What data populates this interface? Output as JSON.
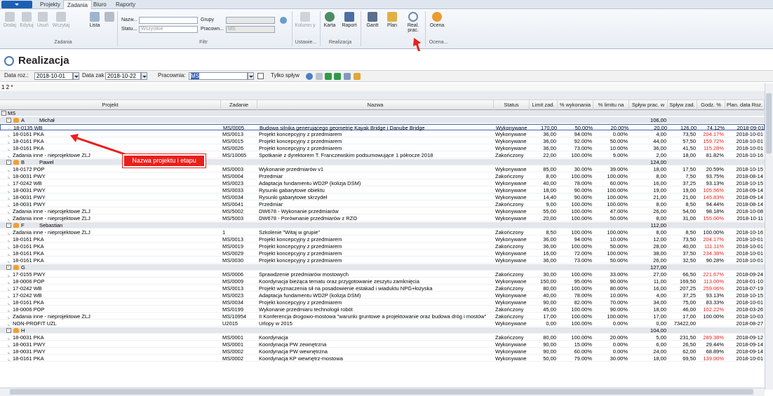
{
  "menu": {
    "tabs": [
      "Projekty",
      "Zadania",
      "Biuro",
      "Raporty"
    ],
    "active": "Zadania"
  },
  "ribbon": {
    "zadania": [
      "Dodaj",
      "Edytuj",
      "Usuń",
      "Wczytaj",
      "Lista"
    ],
    "zadania_group": "Zadania",
    "filter": {
      "nazwa_label": "Nazw...",
      "status_label": "Statu...",
      "status_value": "Wszystkie",
      "grupy_label": "Grupy",
      "pracownik_label": "Pracown...",
      "pracownik_value": "MS",
      "group": "Filtr"
    },
    "ustawienia": {
      "kolumny": "Kolumn y",
      "group": "Ustawie..."
    },
    "realizacja": {
      "karta": "Karta",
      "raport": "Raport",
      "group": "Realizacja"
    },
    "view": {
      "gantt": "Gantt",
      "plan": "Plan",
      "real": "Real. prac."
    },
    "ocena": {
      "label": "Ocena",
      "group": "Ocena..."
    }
  },
  "page": {
    "title": "Realizacja"
  },
  "filters": {
    "data_roz_label": "Data roz.:",
    "data_roz": "2018-10-01",
    "data_zak_label": "Data zak",
    "data_zak": "2018-10-22",
    "pracownia_label": "Pracownia:",
    "pracownia": "MS",
    "tylko_label": "Tylko spływ"
  },
  "pager": "1 2 *",
  "columns": [
    "Projekt",
    "Zadanie",
    "Nazwa",
    "Status",
    "Limit zad.",
    "% wykonania",
    "% limitu na",
    "Spływ prac. w",
    "Spływ zad.",
    "Godz. %",
    "Plan. data Roz."
  ],
  "callout": "Nazwa projektu i etapu",
  "rows": [
    {
      "t": "top",
      "label": "MS"
    },
    {
      "t": "grp",
      "letter": "A",
      "name": "Michał",
      "total": "106,00"
    },
    {
      "t": "d",
      "sel": true,
      "p": "18-0135 WB",
      "z": "MS/0005",
      "n": "Budowa silnika generującego geometrię Kayak Bridge i Danube Bridge",
      "s": "Wykonywane",
      "l": "170,00",
      "w": "50.00%",
      "ln": "20.00%",
      "sp": "20,00",
      "sz": "126,00",
      "g": "74.12%",
      "d": "2018-09-01",
      "red": false
    },
    {
      "t": "d",
      "p": "18-0161 PKA",
      "z": "MS/0013",
      "n": "Projekt koncepcyjny z przedmiarem",
      "s": "Wykonywane",
      "l": "36,00",
      "w": "94.00%",
      "ln": "0.00%",
      "sp": "4,00",
      "sz": "73,50",
      "g": "204.17%",
      "d": "2018-10-01",
      "red": true
    },
    {
      "t": "d",
      "p": "18-0161 PKA",
      "z": "MS/0015",
      "n": "Projekt koncepcyjny z przedmiarem",
      "s": "Wykonywane",
      "l": "36,00",
      "w": "92.00%",
      "ln": "50.00%",
      "sp": "44,00",
      "sz": "57,50",
      "g": "159.72%",
      "d": "2018-10-01",
      "red": true
    },
    {
      "t": "d",
      "p": "18-0161 PKA",
      "z": "MS/0026",
      "n": "Projekt koncepcyjny z przedmiarem",
      "s": "Wykonywane",
      "l": "36,00",
      "w": "73.00%",
      "ln": "10.00%",
      "sp": "36,00",
      "sz": "41,50",
      "g": "115.28%",
      "d": "2018-10-01",
      "red": true
    },
    {
      "t": "d",
      "p": "Zadania inne - nieprojektowe ZLJ",
      "z": "MS/10065",
      "n": "Spotkanie z dyrektorem T. Franczewskim podsumowujące 1 półrocze 2018",
      "s": "Zakończony",
      "l": "22,00",
      "w": "100.00%",
      "ln": "9.00%",
      "sp": "2,00",
      "sz": "18,00",
      "g": "81.82%",
      "d": "2018-10-16",
      "red": false
    },
    {
      "t": "grp",
      "letter": "B",
      "name": "Paweł",
      "total": "124,00"
    },
    {
      "t": "d",
      "p": "18-0172 POP",
      "z": "MS/0003",
      "n": "Wykonanie przedmiarów v1",
      "s": "Wykonywane",
      "l": "85,00",
      "w": "30.00%",
      "ln": "39.00%",
      "sp": "18,00",
      "sz": "17,50",
      "g": "20.59%",
      "d": "2018-10-15",
      "red": false
    },
    {
      "t": "d",
      "p": "18-0031 PWY",
      "z": "MS/0004",
      "n": "Przedmiar",
      "s": "Zakończony",
      "l": "8,00",
      "w": "100.00%",
      "ln": "100.00%",
      "sp": "8,00",
      "sz": "7,50",
      "g": "93.75%",
      "d": "2018-08-14",
      "red": false
    },
    {
      "t": "d",
      "p": "17-0242 WB",
      "z": "MS/0023",
      "n": "Adaptacja fundamentu WD2P (kolizja DSM)",
      "s": "Wykonywane",
      "l": "40,00",
      "w": "78.00%",
      "ln": "60.00%",
      "sp": "16,00",
      "sz": "37,25",
      "g": "93.13%",
      "d": "2018-10-15",
      "red": false
    },
    {
      "t": "d",
      "p": "18-0031 PWY",
      "z": "MS/0033",
      "n": "Rysunki gabarytowe obiektu",
      "s": "Wykonywane",
      "l": "18,00",
      "w": "90.00%",
      "ln": "100.00%",
      "sp": "19,00",
      "sz": "19,00",
      "g": "105.56%",
      "d": "2018-09-14",
      "red": true
    },
    {
      "t": "d",
      "p": "18-0031 PWY",
      "z": "MS/0034",
      "n": "Rysunki gabarytowe skrzydeł",
      "s": "Wykonywane",
      "l": "14,40",
      "w": "90.00%",
      "ln": "100.00%",
      "sp": "21,00",
      "sz": "21,00",
      "g": "145.83%",
      "d": "2018-09-14",
      "red": true
    },
    {
      "t": "d",
      "p": "18-0031 PWY",
      "z": "MS/0041",
      "n": "Przedmiar",
      "s": "Zakończony",
      "l": "9,00",
      "w": "100.00%",
      "ln": "100.00%",
      "sp": "8,00",
      "sz": "8,50",
      "g": "94.44%",
      "d": "2018-08-14",
      "red": false
    },
    {
      "t": "d",
      "p": "Zadania inne - nieprojektowe ZLJ",
      "z": "MS/5002",
      "n": "DW678 - Wykonanie przedmiarów",
      "s": "Wykonywane",
      "l": "55,00",
      "w": "100.00%",
      "ln": "47.00%",
      "sp": "26,00",
      "sz": "54,00",
      "g": "98.18%",
      "d": "2018-10-08",
      "red": false
    },
    {
      "t": "d",
      "p": "Zadania inne - nieprojektowe ZLJ",
      "z": "MS/5003",
      "n": "DW678 - Porównanie przedmiarów z RZO",
      "s": "Wykonywane",
      "l": "20,00",
      "w": "100.00%",
      "ln": "50.00%",
      "sp": "8,00",
      "sz": "31,00",
      "g": "155.00%",
      "d": "2018-10-11",
      "red": true
    },
    {
      "t": "grp",
      "letter": "F",
      "name": "Sebastian",
      "total": "112,00"
    },
    {
      "t": "d",
      "p": "Zadania inne - nieprojektowe ZLJ",
      "z": "1",
      "n": "Szkolenie \"Witaj w grupie\"",
      "s": "Zakończony",
      "l": "8,50",
      "w": "100.00%",
      "ln": "100.00%",
      "sp": "8,00",
      "sz": "8,50",
      "g": "100.00%",
      "d": "2018-10-16",
      "red": false
    },
    {
      "t": "d",
      "p": "18-0161 PKA",
      "z": "MS/0013",
      "n": "Projekt koncepcyjny z przedmiarem",
      "s": "Wykonywane",
      "l": "36,00",
      "w": "94.00%",
      "ln": "10.00%",
      "sp": "12,00",
      "sz": "73,50",
      "g": "204.17%",
      "d": "2018-10-01",
      "red": true
    },
    {
      "t": "d",
      "p": "18-0161 PKA",
      "z": "MS/0019",
      "n": "Projekt koncepcyjny z przedmiarem",
      "s": "Zakończony",
      "l": "36,00",
      "w": "100.00%",
      "ln": "50.00%",
      "sp": "28,00",
      "sz": "40,00",
      "g": "111.11%",
      "d": "2018-10-01",
      "red": true
    },
    {
      "t": "d",
      "p": "18-0161 PKA",
      "z": "MS/0029",
      "n": "Projekt koncepcyjny z przedmiarem",
      "s": "Wykonywane",
      "l": "16,00",
      "w": "72.00%",
      "ln": "100.00%",
      "sp": "38,00",
      "sz": "37,50",
      "g": "234.38%",
      "d": "2018-10-01",
      "red": true
    },
    {
      "t": "d",
      "p": "18-0161 PKA",
      "z": "MS/0030",
      "n": "Projekt koncepcyjny z przedmiarem",
      "s": "Wykonywane",
      "l": "36,00",
      "w": "73.00%",
      "ln": "50.00%",
      "sp": "26,00",
      "sz": "32,50",
      "g": "90.28%",
      "d": "2018-10-01",
      "red": false
    },
    {
      "t": "grp",
      "letter": "G",
      "name": "",
      "total": "127,00"
    },
    {
      "t": "d",
      "p": "17-0155 PWY",
      "z": "MS/0006",
      "n": "Sprawdzenie przedmiarów mostowych",
      "s": "Zakończony",
      "l": "30,00",
      "w": "100.00%",
      "ln": "33.00%",
      "sp": "27,00",
      "sz": "66,50",
      "g": "221.67%",
      "d": "2018-09-24",
      "red": true
    },
    {
      "t": "d",
      "p": "18-0006 POP",
      "z": "MS/0009",
      "n": "Koordynacja bieżąca tematu oraz przygotowanie zeszytu zamknięcia",
      "s": "Wykonywane",
      "l": "150,00",
      "w": "95.00%",
      "ln": "90.00%",
      "sp": "11,00",
      "sz": "169,50",
      "g": "113.00%",
      "d": "2018-01-10",
      "red": true
    },
    {
      "t": "d",
      "p": "17-0242 WB",
      "z": "MS/0013",
      "n": "Projekt wyznaczenia sił na posadowienie estakad i wiaduktu NPG+łożyska",
      "s": "Zakończony",
      "l": "80,00",
      "w": "100.00%",
      "ln": "80.00%",
      "sp": "16,00",
      "sz": "207,25",
      "g": "259.06%",
      "d": "2018-07-19",
      "red": true
    },
    {
      "t": "d",
      "p": "17-0242 WB",
      "z": "MS/0023",
      "n": "Adaptacja fundamentu WD2P (kolizja DSM)",
      "s": "Wykonywane",
      "l": "40,00",
      "w": "78.00%",
      "ln": "10.00%",
      "sp": "4,00",
      "sz": "37,25",
      "g": "93.13%",
      "d": "2018-10-15",
      "red": false
    },
    {
      "t": "d",
      "p": "18-0161 PKA",
      "z": "MS/0034",
      "n": "Projekt koncepcyjny z przedmiarem",
      "s": "Wykonywane",
      "l": "90,00",
      "w": "82.00%",
      "ln": "70.00%",
      "sp": "34,00",
      "sz": "75,00",
      "g": "83.33%",
      "d": "2018-10-01",
      "red": false
    },
    {
      "t": "d",
      "p": "18-0006 POP",
      "z": "MS/0199",
      "n": "Wykonanie przedmiaru technologii robót",
      "s": "Zakończony",
      "l": "45,00",
      "w": "100.00%",
      "ln": "90.00%",
      "sp": "18,00",
      "sz": "46,00",
      "g": "102.22%",
      "d": "2018-03-26",
      "red": true
    },
    {
      "t": "d",
      "p": "Zadania inne - nieprojektowe ZLJ",
      "z": "MS/10954",
      "n": "II Konferencja drogowo-mostowa \"warunki gruntowe a projektowanie oraz budowa dróg i mostów\"",
      "s": "Zakończony",
      "l": "17,00",
      "w": "100.00%",
      "ln": "100.00%",
      "sp": "17,00",
      "sz": "17,00",
      "g": "100.00%",
      "d": "2018-10-03",
      "red": false
    },
    {
      "t": "d",
      "p": "NON-PROFIT UZL",
      "z": "U2015",
      "n": "Urlopy w 2015",
      "s": "Wykonywane",
      "l": "0,00",
      "w": "100.00%",
      "ln": "0.00%",
      "sp": "0,00",
      "sz": "73422,00",
      "g": "",
      "d": "2018-08-27",
      "red": false
    },
    {
      "t": "grp",
      "letter": "H",
      "name": "",
      "total": "104,00"
    },
    {
      "t": "d",
      "p": "18-0031 PKA",
      "z": "MS/0001",
      "n": "Koordynacja",
      "s": "Zakończony",
      "l": "80,00",
      "w": "100.00%",
      "ln": "20.00%",
      "sp": "5,00",
      "sz": "231,50",
      "g": "289.38%",
      "d": "2018-09-12",
      "red": true
    },
    {
      "t": "d",
      "p": "18-0031 PWY",
      "z": "MS/0001",
      "n": "Koordynacja PW zewnętrzna",
      "s": "Wykonywane",
      "l": "90,00",
      "w": "15.00%",
      "ln": "0.00%",
      "sp": "6,00",
      "sz": "26,50",
      "g": "29.44%",
      "d": "2018-09-14",
      "red": false
    },
    {
      "t": "d",
      "p": "18-0031 PWY",
      "z": "MS/0002",
      "n": "Koordynacja PW wewnętrzna",
      "s": "Wykonywane",
      "l": "90,00",
      "w": "60.00%",
      "ln": "0.00%",
      "sp": "24,00",
      "sz": "62,00",
      "g": "68.89%",
      "d": "2018-09-14",
      "red": false
    },
    {
      "t": "d",
      "p": "18-0161 PKA",
      "z": "MS/0002",
      "n": "Koordynacja KP wewnętrz-mostowa",
      "s": "Wykonywane",
      "l": "50,00",
      "w": "79.00%",
      "ln": "30.00%",
      "sp": "18,00",
      "sz": "69,50",
      "g": "139.00%",
      "d": "2018-10-01",
      "red": true
    }
  ]
}
